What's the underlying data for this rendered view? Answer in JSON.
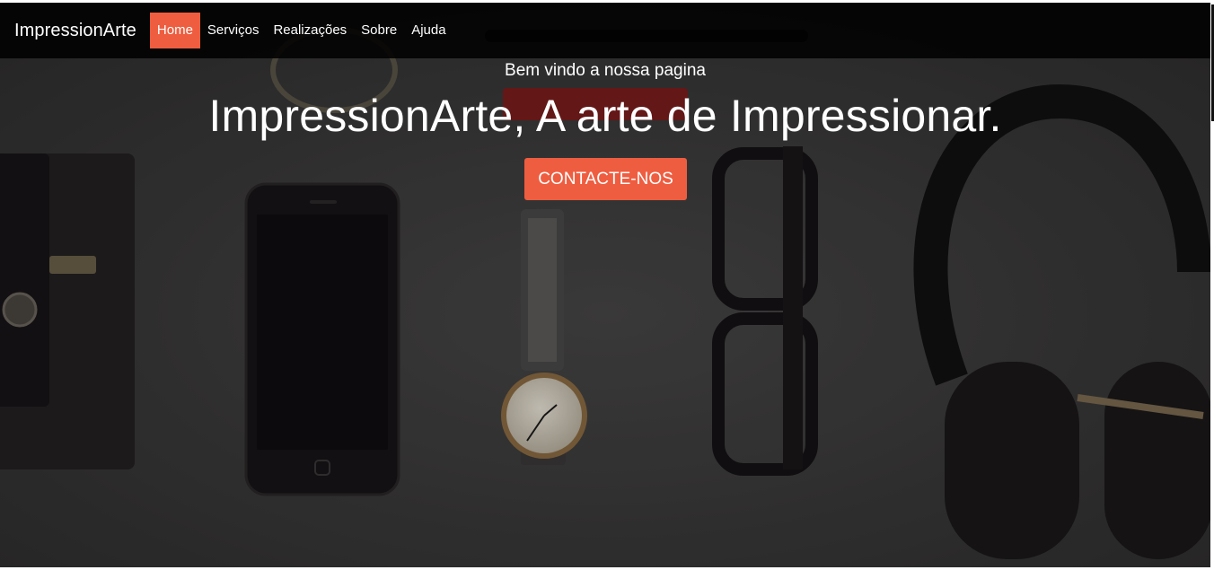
{
  "navbar": {
    "brand": "ImpressionArte",
    "items": [
      {
        "label": "Home",
        "active": true
      },
      {
        "label": "Serviços",
        "active": false
      },
      {
        "label": "Realizações",
        "active": false
      },
      {
        "label": "Sobre",
        "active": false
      },
      {
        "label": "Ajuda",
        "active": false
      }
    ]
  },
  "hero": {
    "subtitle": "Bem vindo a nossa pagina",
    "title": "ImpressionArte, A arte de Impressionar.",
    "cta_label": "CONTACTE-NOS",
    "background_image": "desk-flatlay-photo"
  },
  "colors": {
    "accent": "#ef5d40",
    "navbar_bg": "#000000",
    "text": "#ffffff"
  }
}
